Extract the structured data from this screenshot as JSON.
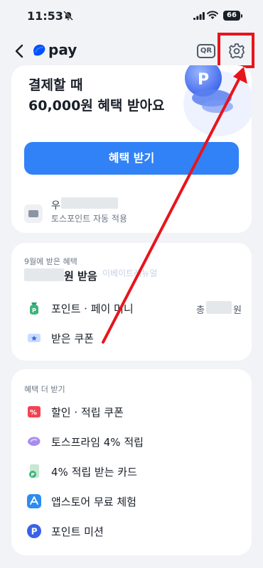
{
  "status_bar": {
    "time": "11:53",
    "battery": "66"
  },
  "nav": {
    "brand": "pay",
    "qr_label": "QR"
  },
  "benefit_card": {
    "headline_line1": "결제할 때",
    "headline_line2": "60,000원 혜택 받아요",
    "cta_label": "혜택 받기",
    "payment_method_name": "우",
    "payment_method_sub": "토스포인트 자동 적용"
  },
  "received_section": {
    "title": "9월에 받은 혜택",
    "received_label": "원 받음",
    "watermark": "이베이트레뉴얼",
    "items": [
      {
        "label": "포인트 · 페이 머니",
        "right_text_prefix": "총",
        "right_text_suffix": "원"
      },
      {
        "label": "받은 쿠폰"
      }
    ]
  },
  "more_section": {
    "title": "혜택 더 받기",
    "items": [
      {
        "label": "할인 · 적립 쿠폰"
      },
      {
        "label": "토스프라임 4% 적립"
      },
      {
        "label": "4% 적립 받는 카드"
      },
      {
        "label": "앱스토어 무료 체험"
      },
      {
        "label": "포인트 미션"
      }
    ]
  },
  "colors": {
    "accent": "#3182f6",
    "annotation": "#e8141c",
    "background": "#f2f3f6"
  }
}
